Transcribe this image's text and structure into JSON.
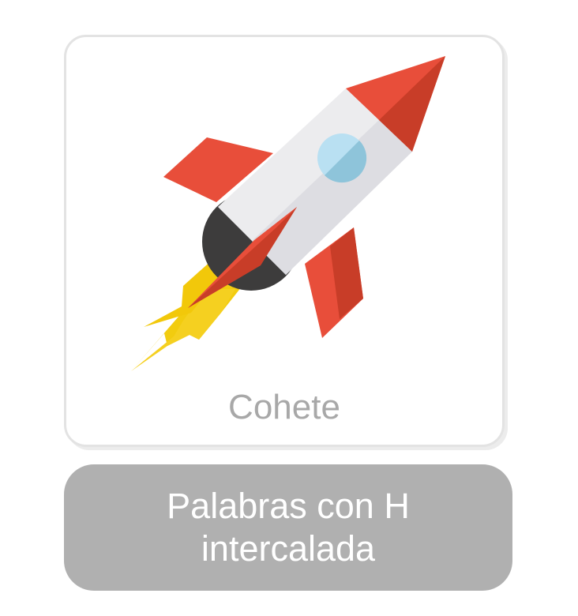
{
  "card": {
    "word": "Cohete",
    "icon": "rocket-icon"
  },
  "category": {
    "label": "Palabras con H intercalada"
  },
  "colors": {
    "card_border": "#e3e3e3",
    "word_text": "#a8a8a8",
    "category_bg": "#b0b0b0",
    "category_text": "#ffffff",
    "rocket_red": "#e84e3a",
    "rocket_dark_red": "#c83d28",
    "rocket_body": "#ebebed",
    "rocket_window": "#a8d5e8",
    "rocket_flame": "#f2cc0f"
  }
}
